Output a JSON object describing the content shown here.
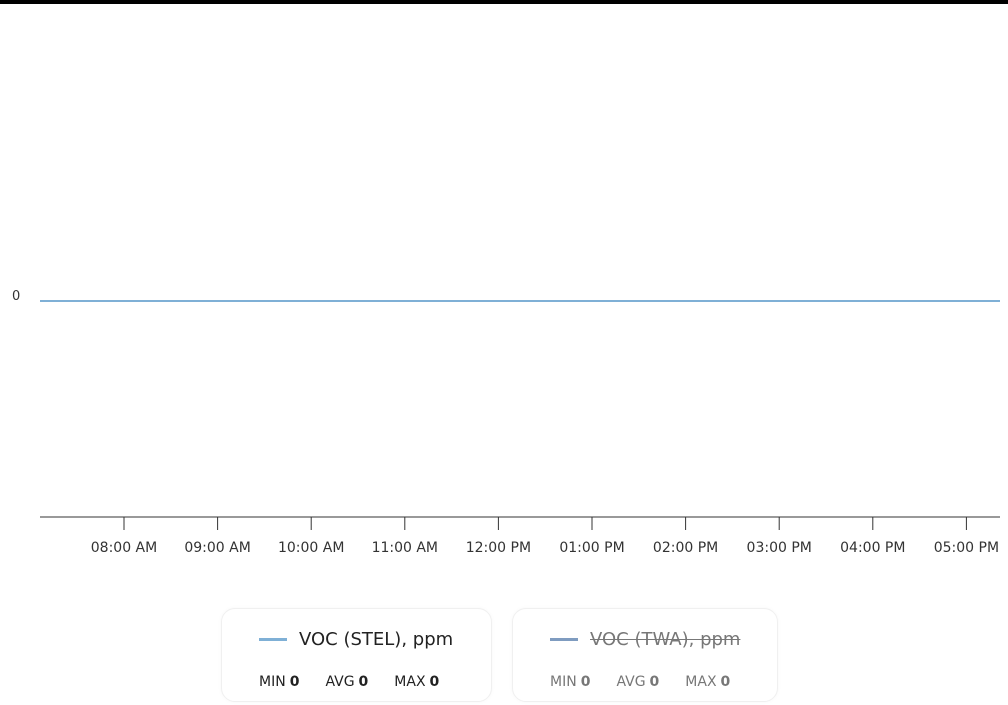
{
  "chart_data": {
    "type": "line",
    "x": [
      "08:00 AM",
      "09:00 AM",
      "10:00 AM",
      "11:00 AM",
      "12:00 PM",
      "01:00 PM",
      "02:00 PM",
      "03:00 PM",
      "04:00 PM",
      "05:00 PM"
    ],
    "x_tick_labels": [
      "08:00 AM",
      "09:00 AM",
      "10:00 AM",
      "11:00 AM",
      "12:00 PM",
      "01:00 PM",
      "02:00 PM",
      "03:00 PM",
      "04:00 PM",
      "05:00 PM"
    ],
    "y_tick_labels": [
      "0"
    ],
    "series": [
      {
        "name": "VOC (STEL), ppm",
        "values": [
          0,
          0,
          0,
          0,
          0,
          0,
          0,
          0,
          0,
          0
        ],
        "color": "#7fb0d6",
        "visible": true,
        "stats": {
          "min": "0",
          "avg": "0",
          "max": "0"
        }
      },
      {
        "name": "VOC (TWA), ppm",
        "values": [
          0,
          0,
          0,
          0,
          0,
          0,
          0,
          0,
          0,
          0
        ],
        "color": "#7f9cc0",
        "visible": false,
        "stats": {
          "min": "0",
          "avg": "0",
          "max": "0"
        }
      }
    ],
    "legend_position": "bottom",
    "grid": false
  },
  "legend": {
    "min_label": "MIN",
    "avg_label": "AVG",
    "max_label": "MAX"
  }
}
